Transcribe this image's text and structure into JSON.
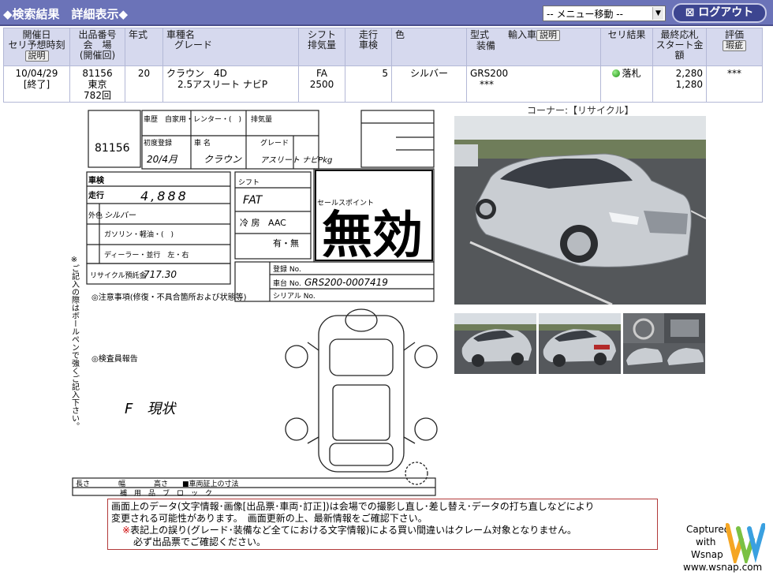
{
  "header": {
    "breadcrumb": "◆検索結果　詳細表示◆",
    "menu_select": "-- メニュー移動 --",
    "logout_label": "ログアウト"
  },
  "table": {
    "headers": {
      "date": "開催日",
      "date_sub": "セリ予想時刻",
      "explain": "説明",
      "lot": "出品番号",
      "venue": "会　場",
      "times": "(開催回)",
      "year": "年式",
      "model": "車種名",
      "grade": "グレード",
      "shift": "シフト",
      "displacement": "排気量",
      "mileage": "走行",
      "inspection": "車検",
      "color": "色",
      "type": "型式　　輸入車",
      "type_explain": "説明",
      "equipment": "装備",
      "result": "セリ結果",
      "final_bid": "最終応札",
      "start_price": "スタート金額",
      "rating": "評価",
      "rating_btn": "瑕疵"
    },
    "row": {
      "date": "10/04/29",
      "status": "[終了]",
      "lot": "81156",
      "venue": "東京",
      "times": "782回",
      "year": "20",
      "model": "クラウン　4D",
      "grade": "2.5アスリート ナビP",
      "shift": "FA",
      "displacement": "2500",
      "mileage": "5",
      "color": "シルバー",
      "type": "GRS200",
      "equipment": "***",
      "result": "落札",
      "final_bid": "2,280",
      "start_price": "1,280",
      "rating": "***"
    }
  },
  "corner_label": "コーナー:【リサイクル】",
  "sheet": {
    "lot": "81156",
    "stamp": "無効",
    "frame_no": "GRS200-0007419",
    "remark": "F　現状"
  },
  "notice": {
    "line1": "画面上のデータ(文字情報･画像[出品票･車両･訂正])は会場での撮影し直し･差し替え･データの打ち直しなどにより",
    "line2": "変更される可能性があります。　画面更新の上、最新情報をご確認下さい。",
    "line3_mark": "※",
    "line3": "表記上の誤り(グレード･装備など全てにおける文字情報)による買い間違いはクレーム対象となりません。",
    "line4": "必ず出品票でご確認ください。"
  },
  "wsnap": {
    "captured": "Captured",
    "with": "with",
    "name": "Wsnap",
    "url": "www.wsnap.com"
  }
}
